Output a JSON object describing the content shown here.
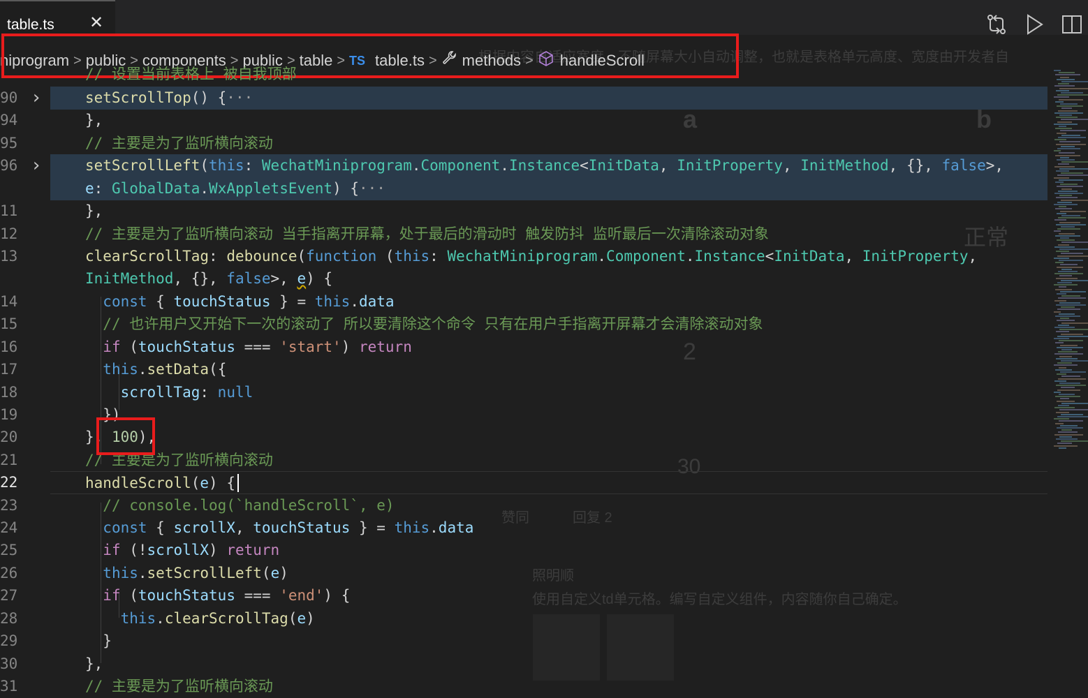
{
  "tab": {
    "title": "table.ts",
    "close_glyph": "✕"
  },
  "breadcrumb": {
    "items": [
      "niprogram",
      "public",
      "components",
      "public",
      "table"
    ],
    "file_badge": "TS",
    "file": "table.ts",
    "methods": "methods",
    "symbol": "handleScroll"
  },
  "gutter": [
    "90",
    "94",
    "95",
    "96",
    "",
    "11",
    "12",
    "13",
    "",
    "14",
    "15",
    "16",
    "17",
    "18",
    "19",
    "20",
    "21",
    "22",
    "23",
    "24",
    "25",
    "26",
    "27",
    "28",
    "29",
    "30",
    "31"
  ],
  "background_text": {
    "letter_a": "a",
    "letter_b": "b",
    "normal": "正常",
    "two": "2",
    "thirty": "30",
    "like": "赞同",
    "reply": "回复 2",
    "username": "照明顺",
    "comment": "使用自定义td单元格。编写自定义组件，内容随你自己确定。",
    "top_text": "根据内容自适应宽度，不随屏幕大小自动调整，也就是表格单元高度、宽度由开发者自"
  },
  "colors": {
    "accent_red": "#e81c1c",
    "comment": "#6a9955",
    "keyword": "#569cd6",
    "type": "#4ec9b0"
  }
}
